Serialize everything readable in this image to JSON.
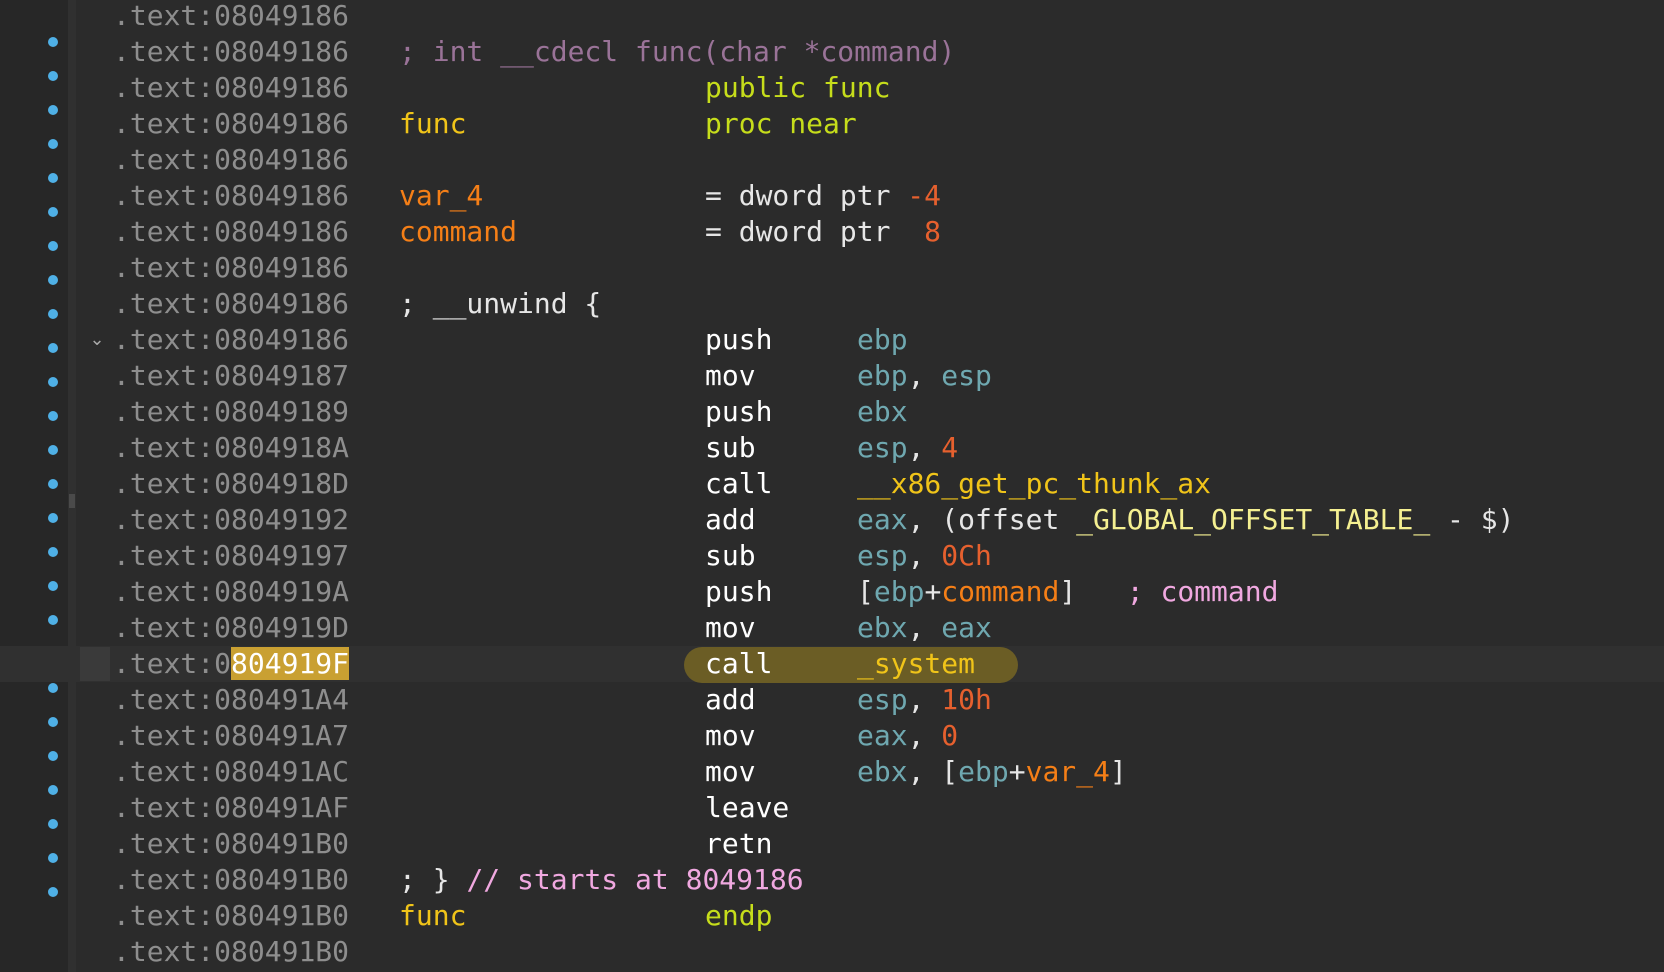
{
  "listing": {
    "segment_prefix": ".text:",
    "lines": [
      {
        "addr": "08049186"
      },
      {
        "addr": "08049186",
        "comment": "; int __cdecl func(char *command)"
      },
      {
        "addr": "08049186",
        "directive": "public func"
      },
      {
        "addr": "08049186",
        "label": "func",
        "directive": "proc near"
      },
      {
        "addr": "08049186"
      },
      {
        "addr": "08049186",
        "label": "var_4",
        "decl_type": "= dword ptr",
        "decl_value": "-4"
      },
      {
        "addr": "08049186",
        "label": "command",
        "decl_type": "= dword ptr",
        "decl_value": "8"
      },
      {
        "addr": "08049186"
      },
      {
        "addr": "08049186",
        "comment": "; __unwind {"
      },
      {
        "addr": "08049186",
        "mnemonic": "push",
        "operand": "ebp"
      },
      {
        "addr": "08049187",
        "mnemonic": "mov",
        "operand": "ebp",
        "operand2": "esp"
      },
      {
        "addr": "08049189",
        "mnemonic": "push",
        "operand": "ebx"
      },
      {
        "addr": "0804918A",
        "mnemonic": "sub",
        "operand": "esp",
        "operand2": "4"
      },
      {
        "addr": "0804918D",
        "mnemonic": "call",
        "target": "__x86_get_pc_thunk_ax"
      },
      {
        "addr": "08049192",
        "mnemonic": "add",
        "operand": "eax",
        "expr_open": "(offset",
        "global": "_GLOBAL_OFFSET_TABLE_",
        "expr_close": "- $)"
      },
      {
        "addr": "08049197",
        "mnemonic": "sub",
        "operand": "esp",
        "operand2": "0Ch"
      },
      {
        "addr": "0804919A",
        "mnemonic": "push",
        "mem_base": "ebp",
        "mem_var": "command",
        "inline_comment": "; command"
      },
      {
        "addr": "0804919D",
        "mnemonic": "mov",
        "operand": "ebx",
        "operand2": "eax"
      },
      {
        "addr": "0804919F",
        "addr_head": "0",
        "addr_tail": "804919F",
        "mnemonic": "call",
        "target": "_system"
      },
      {
        "addr": "080491A4",
        "mnemonic": "add",
        "operand": "esp",
        "operand2": "10h"
      },
      {
        "addr": "080491A7",
        "mnemonic": "mov",
        "operand": "eax",
        "operand2": "0"
      },
      {
        "addr": "080491AC",
        "mnemonic": "mov",
        "operand": "ebx",
        "mem_base": "ebp",
        "mem_var": "var_4"
      },
      {
        "addr": "080491AF",
        "mnemonic": "leave"
      },
      {
        "addr": "080491B0",
        "mnemonic": "retn"
      },
      {
        "addr": "080491B0",
        "comment_prefix": "; }",
        "comment_text": "// starts at 8049186"
      },
      {
        "addr": "080491B0",
        "label": "func",
        "directive": "endp"
      },
      {
        "addr": "080491B0"
      }
    ]
  },
  "gutter": {
    "collapse_icon": "chevron-down-icon",
    "breakpoint_icon": "breakpoint-dot-icon"
  },
  "colors": {
    "background": "#2b2b2b",
    "address": "#8e8e8e",
    "highlight_address": "#c9a032",
    "highlight_call": "#6b5d25",
    "breakpoint_dot": "#4fb0e6",
    "label": "#f57f17",
    "directive": "#c6dd1b",
    "register": "#6fa8b0",
    "number": "#e6602e",
    "function_name": "#f0c419",
    "comment": "#f0a8e0"
  }
}
